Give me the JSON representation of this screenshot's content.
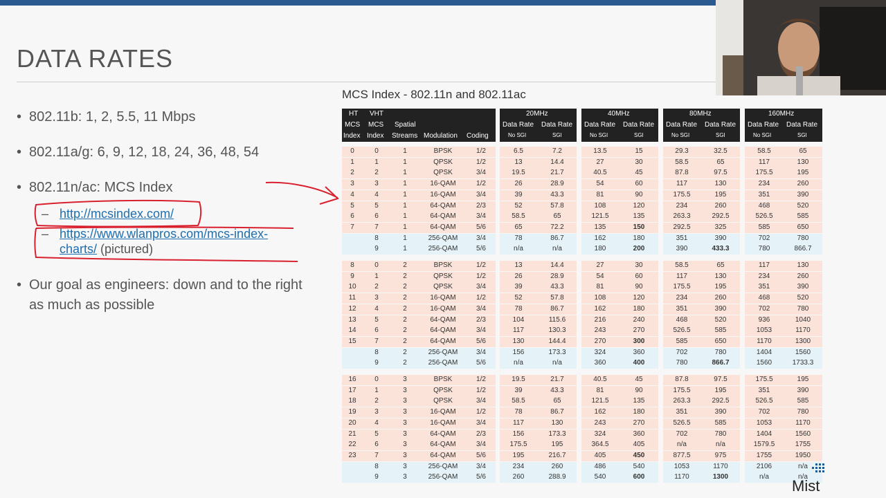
{
  "title": "DATA RATES",
  "bullets": [
    {
      "text": "802.11b: 1, 2, 5.5, 11 Mbps"
    },
    {
      "text": "802.11a/g: 6, 9, 12, 18, 24, 36, 48, 54"
    },
    {
      "text": "802.11n/ac: MCS Index"
    },
    {
      "text": "Our goal as engineers: down and to the right as much as possible"
    }
  ],
  "subbullets": [
    {
      "link": "http://mcsindex.com/",
      "suffix": ""
    },
    {
      "link_line1": "https://www.wlanpros.com/mcs-index-",
      "link_line2": "charts/",
      "suffix": " (pictured)"
    }
  ],
  "table": {
    "title": "MCS Index - 802.11n and 802.11ac",
    "headers": {
      "ht": "HT",
      "vht": "VHT",
      "mcs1": "MCS",
      "mcs2": "MCS",
      "index1": "Index",
      "index2": "Index",
      "spatial": "Spatial",
      "streams": "Streams",
      "modulation": "Modulation",
      "coding": "Coding",
      "bw": [
        "20MHz",
        "40MHz",
        "80MHz",
        "160MHz"
      ],
      "datarate": "Data Rate",
      "nosgi": "No SGI",
      "sgi": "SGI"
    },
    "rows": [
      [
        "0",
        "0",
        "1",
        "BPSK",
        "1/2",
        "6.5",
        "7.2",
        "13.5",
        "15",
        "29.3",
        "32.5",
        "58.5",
        "65"
      ],
      [
        "1",
        "1",
        "1",
        "QPSK",
        "1/2",
        "13",
        "14.4",
        "27",
        "30",
        "58.5",
        "65",
        "117",
        "130"
      ],
      [
        "2",
        "2",
        "1",
        "QPSK",
        "3/4",
        "19.5",
        "21.7",
        "40.5",
        "45",
        "87.8",
        "97.5",
        "175.5",
        "195"
      ],
      [
        "3",
        "3",
        "1",
        "16-QAM",
        "1/2",
        "26",
        "28.9",
        "54",
        "60",
        "117",
        "130",
        "234",
        "260"
      ],
      [
        "4",
        "4",
        "1",
        "16-QAM",
        "3/4",
        "39",
        "43.3",
        "81",
        "90",
        "175.5",
        "195",
        "351",
        "390"
      ],
      [
        "5",
        "5",
        "1",
        "64-QAM",
        "2/3",
        "52",
        "57.8",
        "108",
        "120",
        "234",
        "260",
        "468",
        "520"
      ],
      [
        "6",
        "6",
        "1",
        "64-QAM",
        "3/4",
        "58.5",
        "65",
        "121.5",
        "135",
        "263.3",
        "292.5",
        "526.5",
        "585"
      ],
      [
        "7",
        "7",
        "1",
        "64-QAM",
        "5/6",
        "65",
        "72.2",
        "135",
        "150",
        "292.5",
        "325",
        "585",
        "650"
      ],
      [
        "",
        "8",
        "1",
        "256-QAM",
        "3/4",
        "78",
        "86.7",
        "162",
        "180",
        "351",
        "390",
        "702",
        "780"
      ],
      [
        "",
        "9",
        "1",
        "256-QAM",
        "5/6",
        "n/a",
        "n/a",
        "180",
        "200",
        "390",
        "433.3",
        "780",
        "866.7"
      ],
      [
        "8",
        "0",
        "2",
        "BPSK",
        "1/2",
        "13",
        "14.4",
        "27",
        "30",
        "58.5",
        "65",
        "117",
        "130"
      ],
      [
        "9",
        "1",
        "2",
        "QPSK",
        "1/2",
        "26",
        "28.9",
        "54",
        "60",
        "117",
        "130",
        "234",
        "260"
      ],
      [
        "10",
        "2",
        "2",
        "QPSK",
        "3/4",
        "39",
        "43.3",
        "81",
        "90",
        "175.5",
        "195",
        "351",
        "390"
      ],
      [
        "11",
        "3",
        "2",
        "16-QAM",
        "1/2",
        "52",
        "57.8",
        "108",
        "120",
        "234",
        "260",
        "468",
        "520"
      ],
      [
        "12",
        "4",
        "2",
        "16-QAM",
        "3/4",
        "78",
        "86.7",
        "162",
        "180",
        "351",
        "390",
        "702",
        "780"
      ],
      [
        "13",
        "5",
        "2",
        "64-QAM",
        "2/3",
        "104",
        "115.6",
        "216",
        "240",
        "468",
        "520",
        "936",
        "1040"
      ],
      [
        "14",
        "6",
        "2",
        "64-QAM",
        "3/4",
        "117",
        "130.3",
        "243",
        "270",
        "526.5",
        "585",
        "1053",
        "1170"
      ],
      [
        "15",
        "7",
        "2",
        "64-QAM",
        "5/6",
        "130",
        "144.4",
        "270",
        "300",
        "585",
        "650",
        "1170",
        "1300"
      ],
      [
        "",
        "8",
        "2",
        "256-QAM",
        "3/4",
        "156",
        "173.3",
        "324",
        "360",
        "702",
        "780",
        "1404",
        "1560"
      ],
      [
        "",
        "9",
        "2",
        "256-QAM",
        "5/6",
        "n/a",
        "n/a",
        "360",
        "400",
        "780",
        "866.7",
        "1560",
        "1733.3"
      ],
      [
        "16",
        "0",
        "3",
        "BPSK",
        "1/2",
        "19.5",
        "21.7",
        "40.5",
        "45",
        "87.8",
        "97.5",
        "175.5",
        "195"
      ],
      [
        "17",
        "1",
        "3",
        "QPSK",
        "1/2",
        "39",
        "43.3",
        "81",
        "90",
        "175.5",
        "195",
        "351",
        "390"
      ],
      [
        "18",
        "2",
        "3",
        "QPSK",
        "3/4",
        "58.5",
        "65",
        "121.5",
        "135",
        "263.3",
        "292.5",
        "526.5",
        "585"
      ],
      [
        "19",
        "3",
        "3",
        "16-QAM",
        "1/2",
        "78",
        "86.7",
        "162",
        "180",
        "351",
        "390",
        "702",
        "780"
      ],
      [
        "20",
        "4",
        "3",
        "16-QAM",
        "3/4",
        "117",
        "130",
        "243",
        "270",
        "526.5",
        "585",
        "1053",
        "1170"
      ],
      [
        "21",
        "5",
        "3",
        "64-QAM",
        "2/3",
        "156",
        "173.3",
        "324",
        "360",
        "702",
        "780",
        "1404",
        "1560"
      ],
      [
        "22",
        "6",
        "3",
        "64-QAM",
        "3/4",
        "175.5",
        "195",
        "364.5",
        "405",
        "n/a",
        "n/a",
        "1579.5",
        "1755"
      ],
      [
        "23",
        "7",
        "3",
        "64-QAM",
        "5/6",
        "195",
        "216.7",
        "405",
        "450",
        "877.5",
        "975",
        "1755",
        "1950"
      ],
      [
        "",
        "8",
        "3",
        "256-QAM",
        "3/4",
        "234",
        "260",
        "486",
        "540",
        "1053",
        "1170",
        "2106",
        "n/a"
      ],
      [
        "",
        "9",
        "3",
        "256-QAM",
        "5/6",
        "260",
        "288.9",
        "540",
        "600",
        "1170",
        "1300",
        "n/a",
        "n/a"
      ]
    ]
  },
  "logo": "Mist",
  "colors": {
    "accent": "#2a5a8f",
    "annotation": "#d8202e",
    "link": "#1f6fb0",
    "header": "#222222"
  }
}
